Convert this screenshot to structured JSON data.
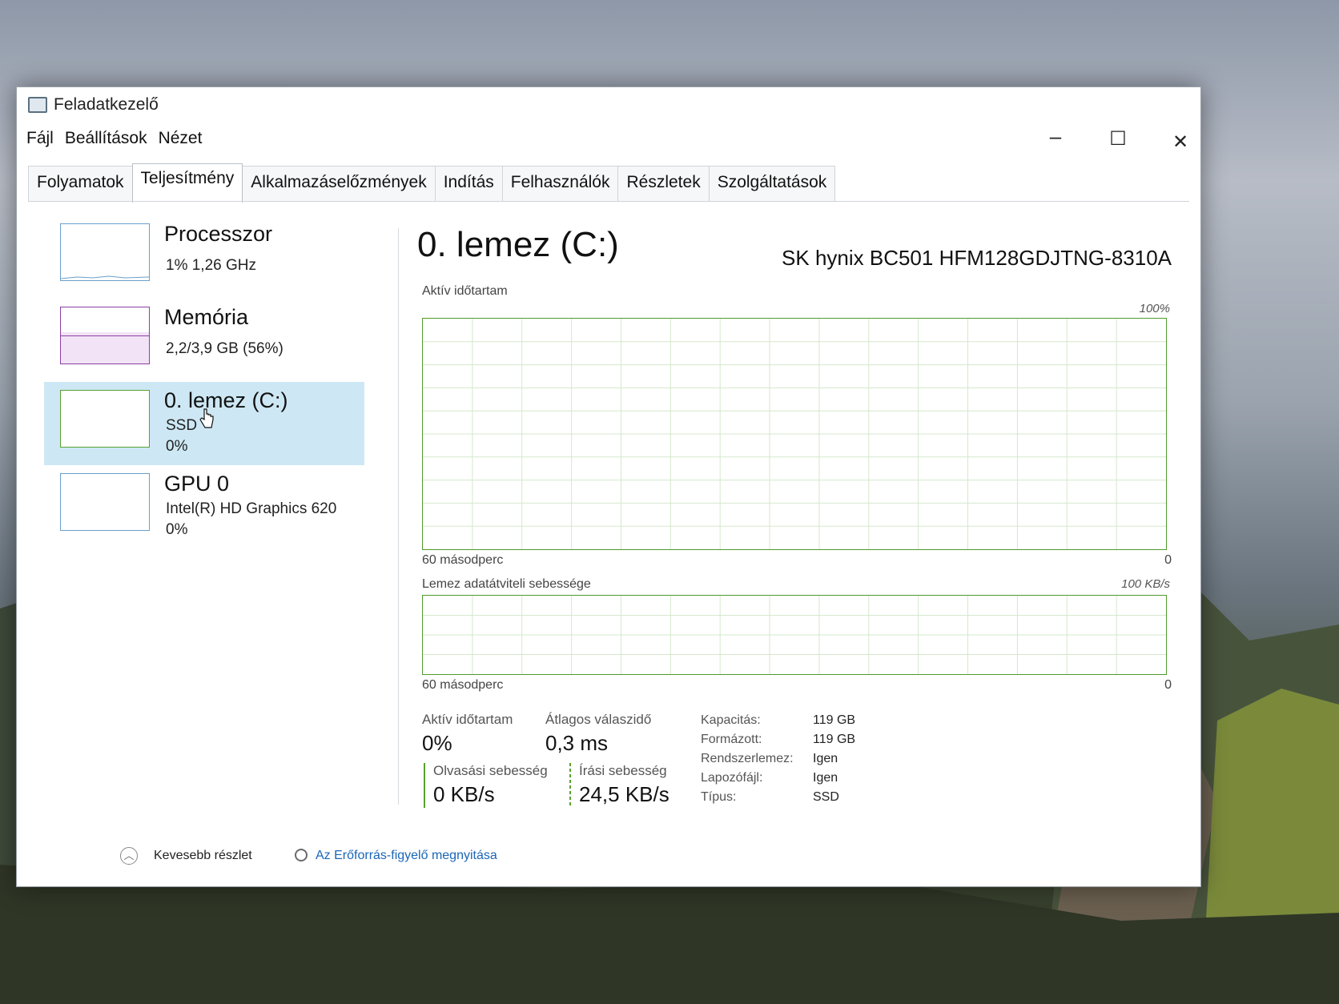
{
  "window": {
    "title": "Feladatkezelő",
    "minimize": "–",
    "maximize": "☐",
    "close": "✕"
  },
  "menu": [
    "Fájl",
    "Beállítások",
    "Nézet"
  ],
  "tabs": [
    "Folyamatok",
    "Teljesítmény",
    "Alkalmazáselőzmények",
    "Indítás",
    "Felhasználók",
    "Részletek",
    "Szolgáltatások"
  ],
  "active_tab": "Teljesítmény",
  "sidebar": {
    "processor": {
      "name": "Processzor",
      "sub": "1% 1,26 GHz"
    },
    "memory": {
      "name": "Memória",
      "sub": "2,2/3,9 GB (56%)",
      "usage_fraction": 0.56
    },
    "disk": {
      "name": "0. lemez (C:)",
      "sub1": "SSD",
      "sub2": "0%"
    },
    "gpu": {
      "name": "GPU 0",
      "sub1": "Intel(R) HD Graphics 620",
      "sub2": "0%"
    }
  },
  "main": {
    "title": "0. lemez (C:)",
    "model": "SK hynix BC501 HFM128GDJTNG-8310A",
    "active_graph": {
      "label": "Aktív időtartam",
      "max_label": "100%",
      "min_label": "0",
      "time_label": "60 másodperc"
    },
    "transfer_graph": {
      "label": "Lemez adatátviteli sebessége",
      "max_label": "100 KB/s",
      "min_label": "0",
      "time_label": "60 másodperc"
    },
    "stats": {
      "active_label": "Aktív időtartam",
      "active_value": "0%",
      "response_label": "Átlagos válaszidő",
      "response_value": "0,3 ms",
      "read_label": "Olvasási sebesség",
      "read_value": "0 KB/s",
      "write_label": "Írási sebesség",
      "write_value": "24,5 KB/s"
    },
    "properties": [
      {
        "key": "Kapacitás:",
        "value": "119 GB"
      },
      {
        "key": "Formázott:",
        "value": "119 GB"
      },
      {
        "key": "Rendszerlemez:",
        "value": "Igen"
      },
      {
        "key": "Lapozófájl:",
        "value": "Igen"
      },
      {
        "key": "Típus:",
        "value": "SSD"
      }
    ]
  },
  "footer": {
    "fewer_details": "Kevesebb részlet",
    "resource_monitor": "Az Erőforrás-figyelő megnyitása"
  },
  "colors": {
    "disk_accent": "#5aa032",
    "memory_accent": "#8b3fa6",
    "cpu_accent": "#6a9fc9",
    "selected_bg": "#cde8f4",
    "link": "#1a66b8"
  }
}
